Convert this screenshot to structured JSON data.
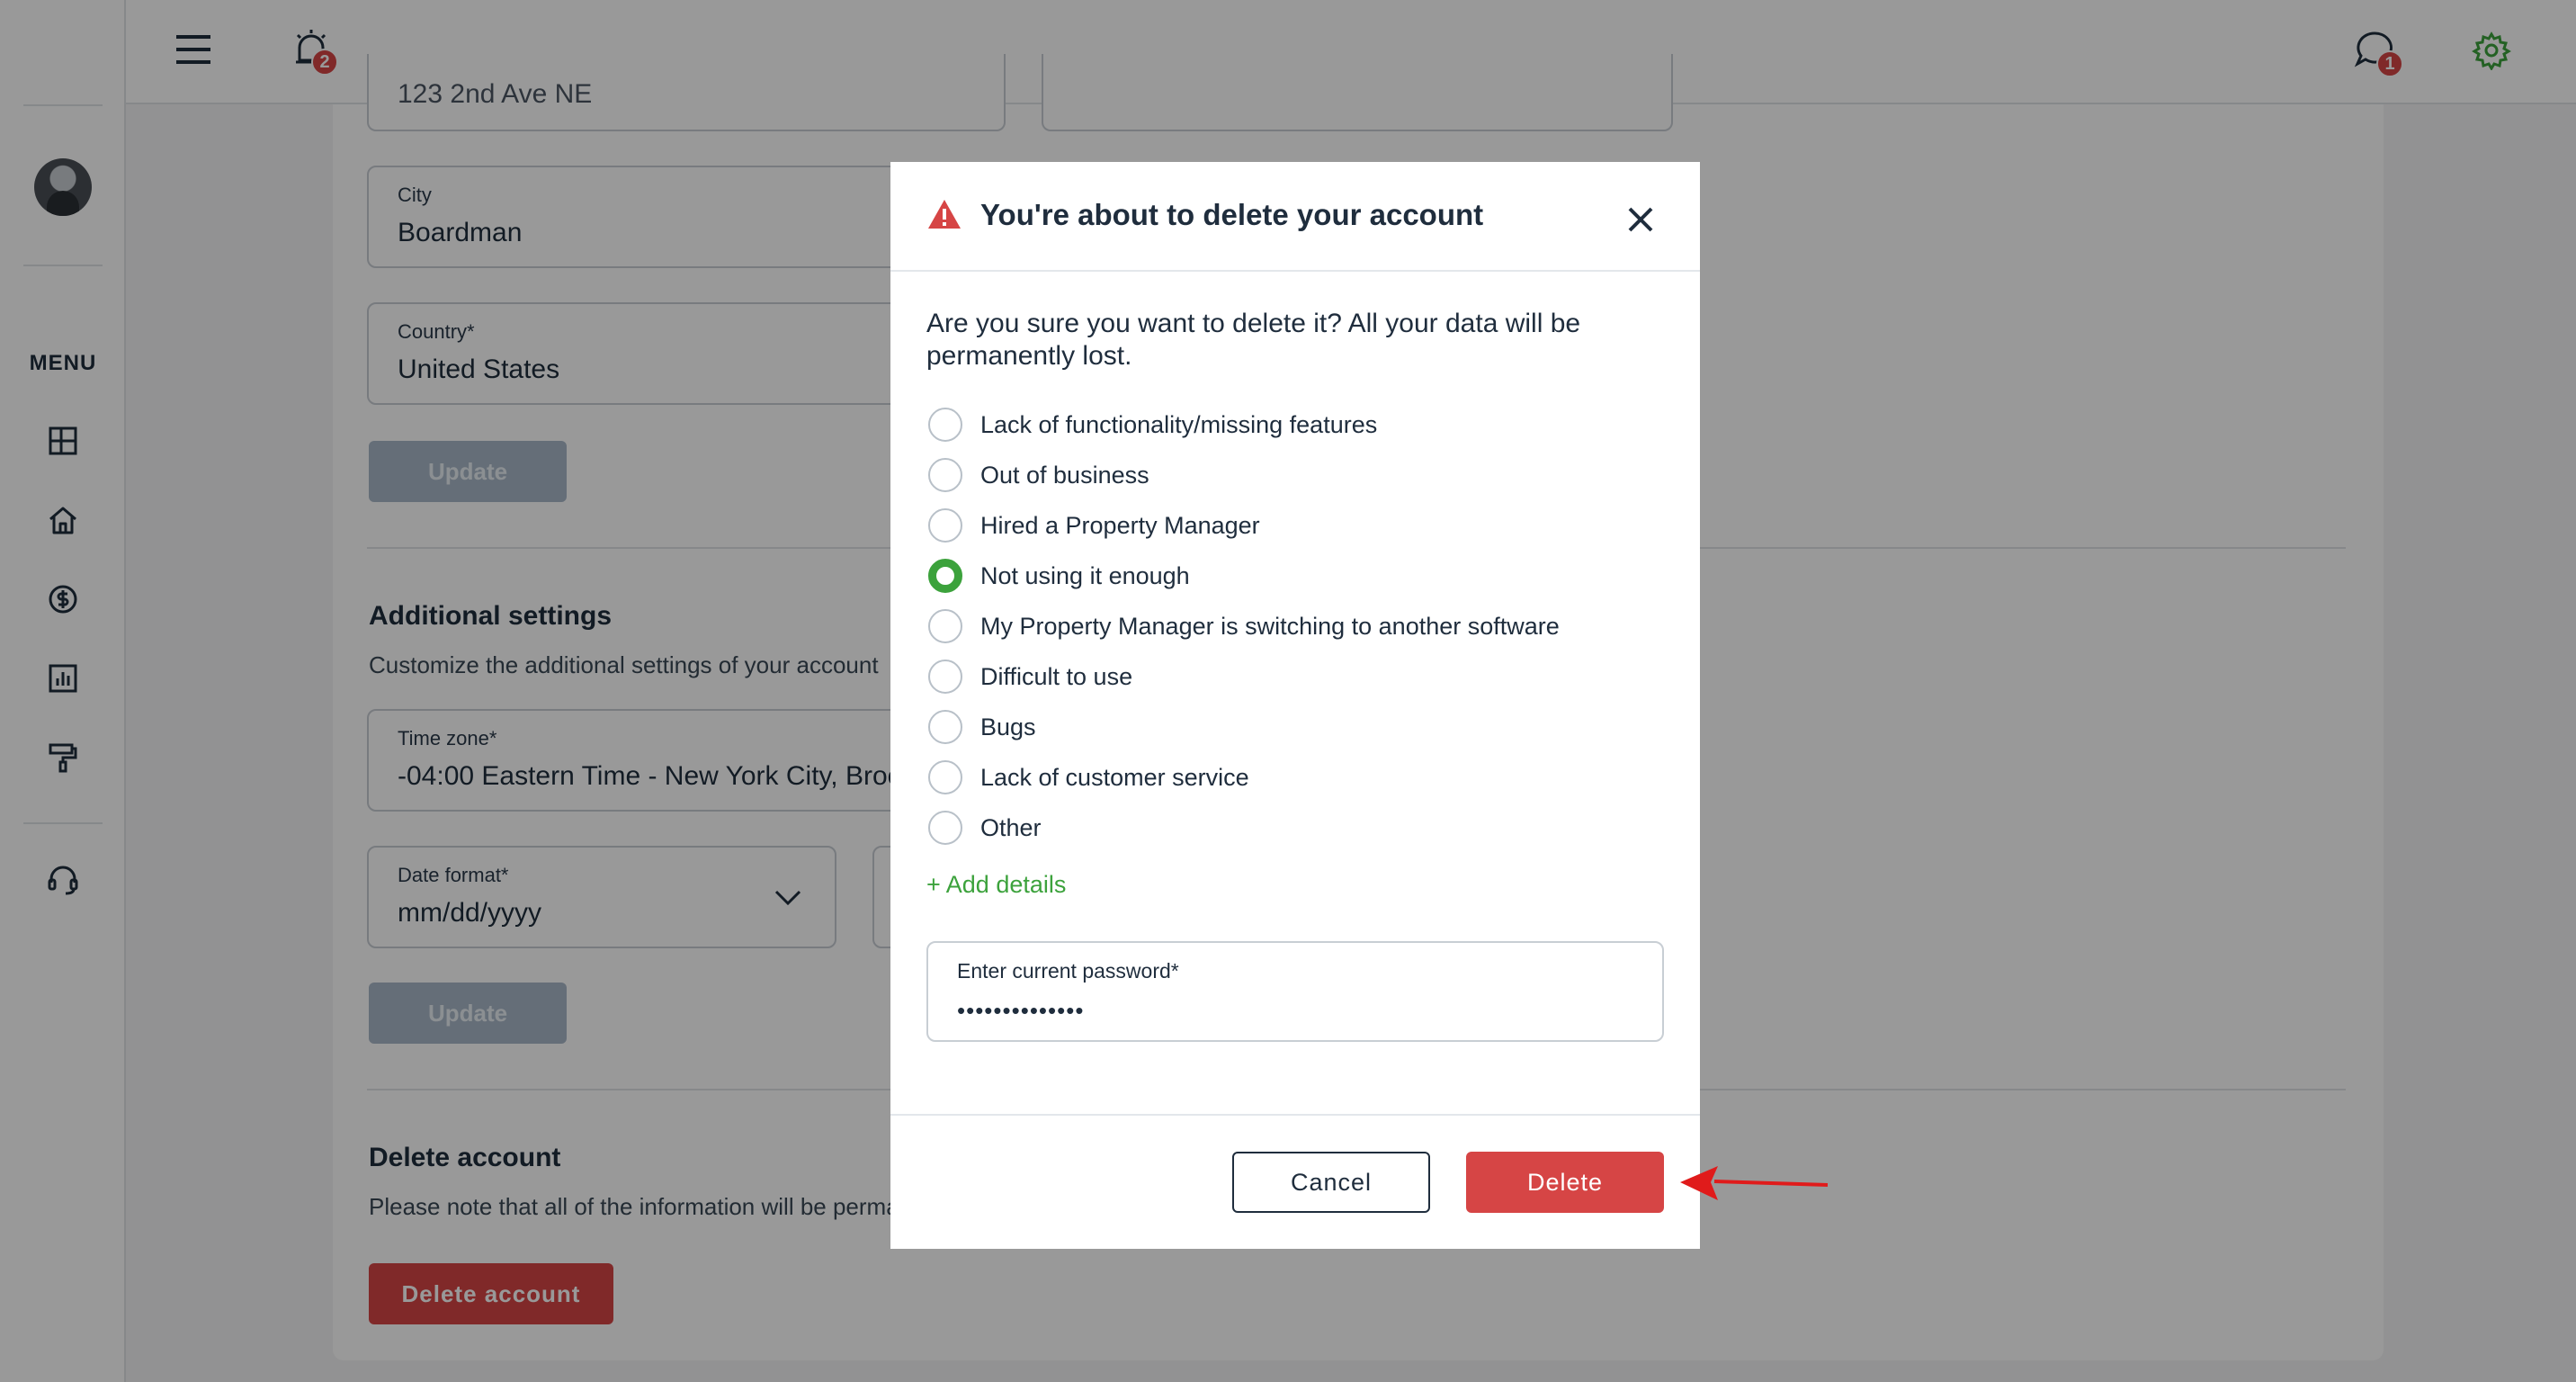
{
  "topbar": {
    "notifications_count": "2",
    "messages_count": "1"
  },
  "sidebar": {
    "menu_label": "MENU",
    "items": [
      "dashboard-icon",
      "home-icon",
      "dollar-icon",
      "reports-icon",
      "paint-roller-icon",
      "support-headset-icon"
    ]
  },
  "profile_form": {
    "street_value": "123 2nd Ave NE",
    "city_label": "City",
    "city_value": "Boardman",
    "country_label": "Country*",
    "country_value": "United States",
    "update_label": "Update"
  },
  "additional_settings": {
    "title": "Additional settings",
    "description": "Customize the additional settings of your account",
    "timezone_label": "Time zone*",
    "timezone_value": "-04:00 Eastern Time - New York City, Brooklyn",
    "date_format_label": "Date format*",
    "date_format_value": "mm/dd/yyyy",
    "update_label": "Update"
  },
  "delete_section": {
    "title": "Delete account",
    "description": "Please note that all of the information will be permanently deleted",
    "button_label": "Delete account"
  },
  "modal": {
    "title": "You're about to delete your account",
    "question": "Are you sure you want to delete it? All your data will be permanently lost.",
    "options": [
      {
        "label": "Lack of functionality/missing features",
        "checked": false
      },
      {
        "label": "Out of business",
        "checked": false
      },
      {
        "label": "Hired a Property Manager",
        "checked": false
      },
      {
        "label": "Not using it enough",
        "checked": true
      },
      {
        "label": "My Property Manager is switching to another software",
        "checked": false
      },
      {
        "label": "Difficult to use",
        "checked": false
      },
      {
        "label": "Bugs",
        "checked": false
      },
      {
        "label": "Lack of customer service",
        "checked": false
      },
      {
        "label": "Other",
        "checked": false
      }
    ],
    "add_details": "+ Add details",
    "password_label": "Enter current password*",
    "password_value": "••••••••••••••",
    "cancel_label": "Cancel",
    "delete_label": "Delete"
  },
  "colors": {
    "danger": "#d64545",
    "success": "#3ca23c",
    "text": "#1f2d3d",
    "disabled": "#a9b8c8"
  }
}
